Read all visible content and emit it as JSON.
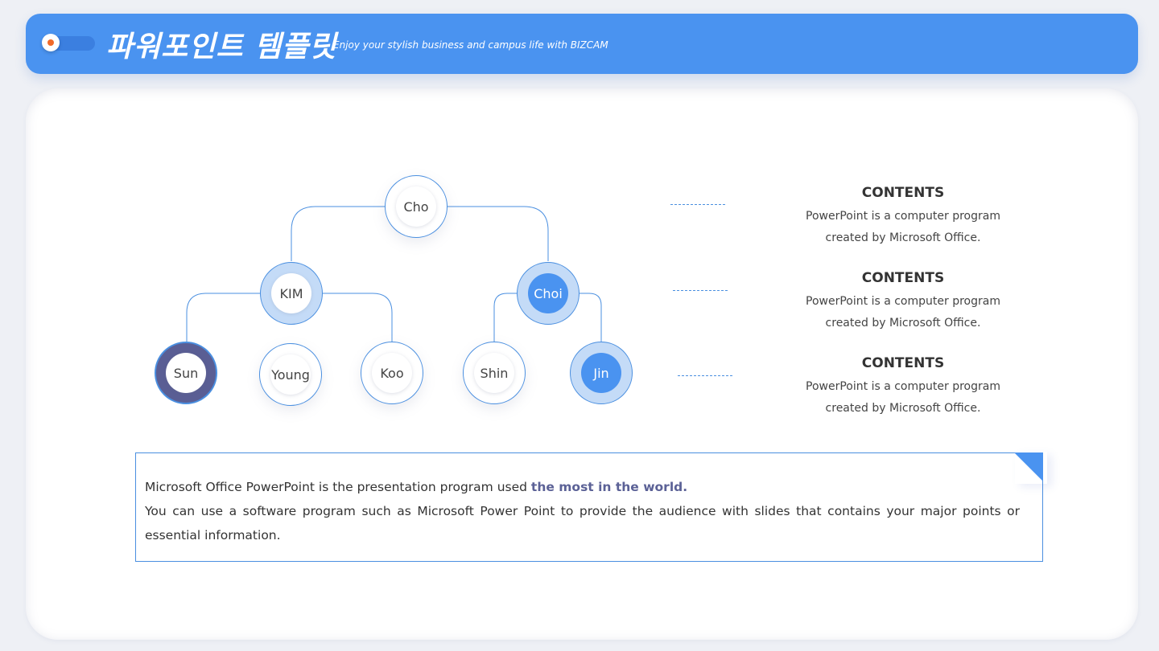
{
  "header": {
    "title": "파워포인트 템플릿",
    "subtitle": "Enjoy your stylish business and campus life with BIZCAM"
  },
  "colors": {
    "accent_blue": "#4a93f0",
    "line_blue": "#4a8fe0",
    "light_blue": "#c4dbf7",
    "navy": "#5a5e94",
    "orange_dot": "#f06a2a"
  },
  "tree": {
    "root": "Cho",
    "level2": [
      "KIM",
      "Choi"
    ],
    "level3": [
      "Sun",
      "Young",
      "Koo",
      "Shin",
      "Jin"
    ]
  },
  "contents": [
    {
      "title": "CONTENTS",
      "line1": "PowerPoint is a computer program",
      "line2": "created by Microsoft Office."
    },
    {
      "title": "CONTENTS",
      "line1": "PowerPoint is a computer program",
      "line2": "created by Microsoft Office."
    },
    {
      "title": "CONTENTS",
      "line1": "PowerPoint is a computer program",
      "line2": "created by Microsoft Office."
    }
  ],
  "textbox": {
    "line1_normal": "Microsoft Office PowerPoint is the presentation program used ",
    "line1_bold": "the most in the world.",
    "line2": "You can use a software program such as Microsoft Power Point to provide the audience with slides that contains your major points or essential information."
  }
}
